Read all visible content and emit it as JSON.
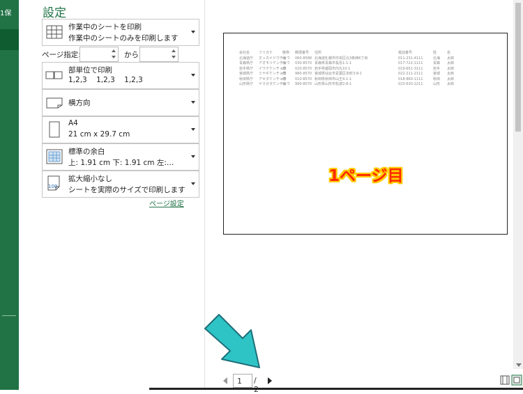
{
  "backstage": {
    "fragment": "1保"
  },
  "settings": {
    "title": "設定",
    "print_what": {
      "line1": "作業中のシートを印刷",
      "line2": "作業中のシートのみを印刷します"
    },
    "pages": {
      "label": "ページ指定:",
      "from_value": "",
      "to_label": "から",
      "to_value": ""
    },
    "collate": {
      "line1": "部単位で印刷",
      "line2": "1,2,3    1,2,3    1,2,3"
    },
    "orientation": {
      "label": "横方向"
    },
    "paper_size": {
      "line1": "A4",
      "line2": "21 cm x 29.7 cm"
    },
    "margins": {
      "line1": "標準の余白",
      "line2": "上: 1.91 cm 下: 1.91 cm 左:…"
    },
    "scaling": {
      "line1": "拡大縮小なし",
      "line2": "シートを実際のサイズで印刷します",
      "icon_text": "100"
    },
    "page_setup_link": "ページ設定"
  },
  "preview": {
    "page_label": "1ページ目",
    "table_header": [
      "会社名",
      "フリガナ",
      "敬称",
      "郵便番号",
      "住所",
      "電話番号",
      "姓",
      "名"
    ],
    "table_rows": [
      [
        "北海道庁",
        "ホッカイドウチョウ",
        "様",
        "060-8588",
        "北海道札幌市中央区北3条西6丁目",
        "011-231-4111",
        "北海",
        "太郎"
      ],
      [
        "青森県庁",
        "アオモリケンチョウ",
        "様",
        "030-8570",
        "青森県青森市長島1-1-1",
        "017-722-1111",
        "青森",
        "太郎"
      ],
      [
        "岩手県庁",
        "イワテケンチョウ",
        "様",
        "020-8570",
        "岩手県盛岡市内丸10-1",
        "019-651-3111",
        "岩手",
        "太郎"
      ],
      [
        "宮城県庁",
        "ミヤギケンチョウ",
        "様",
        "980-8570",
        "宮城県仙台市青葉区本町3-8-1",
        "022-211-2111",
        "宮城",
        "太郎"
      ],
      [
        "秋田県庁",
        "アキタケンチョウ",
        "様",
        "010-8570",
        "秋田県秋田市山王4-1-1",
        "018-860-1111",
        "秋田",
        "太郎"
      ],
      [
        "山形県庁",
        "ヤマガタケンチョウ",
        "様",
        "990-8570",
        "山形県山形市松波2-8-1",
        "023-630-2211",
        "山形",
        "太郎"
      ]
    ]
  },
  "pager": {
    "current": "1",
    "total_label": "/ 2"
  },
  "colors": {
    "excel_green": "#217346",
    "arrow": "#2ec4c6",
    "label_red": "#ff2a00",
    "label_yellow": "#ffcd00"
  }
}
